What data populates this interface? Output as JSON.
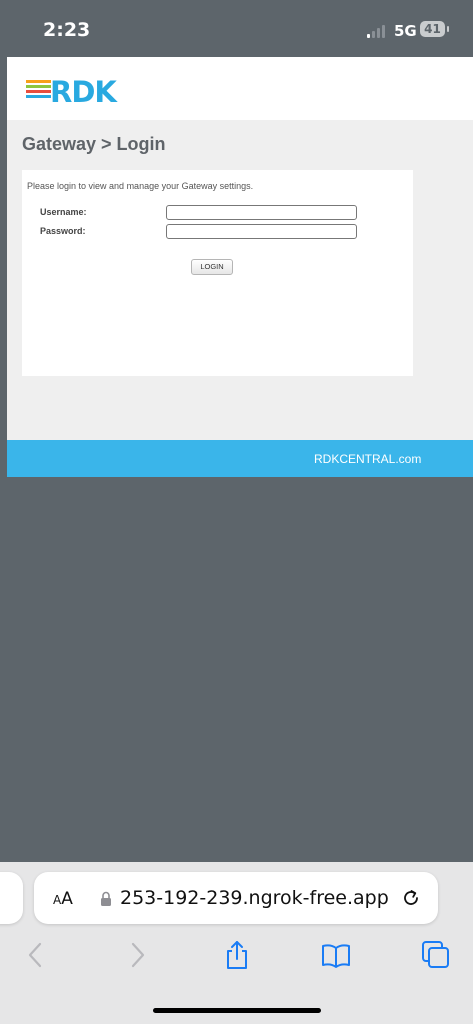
{
  "status_bar": {
    "time": "2:23",
    "network": "5G",
    "battery": "41"
  },
  "page": {
    "logo_text": "RDK",
    "logo_bar_colors": [
      "#f7a11a",
      "#8dc63f",
      "#e94e3d",
      "#29a9e0"
    ],
    "title": "Gateway > Login",
    "intro": "Please login to view and manage your Gateway settings.",
    "username_label": "Username:",
    "username_value": "",
    "password_label": "Password:",
    "password_value": "",
    "login_label": "LOGIN",
    "footer_link": "RDKCENTRAL.com"
  },
  "browser": {
    "text_size_label_small": "A",
    "text_size_label_large": "A",
    "url": "253-192-239.ngrok-free.app"
  },
  "colors": {
    "accent": "#3ab5ea",
    "brand": "#29a9e0",
    "background": "#5d656b"
  }
}
